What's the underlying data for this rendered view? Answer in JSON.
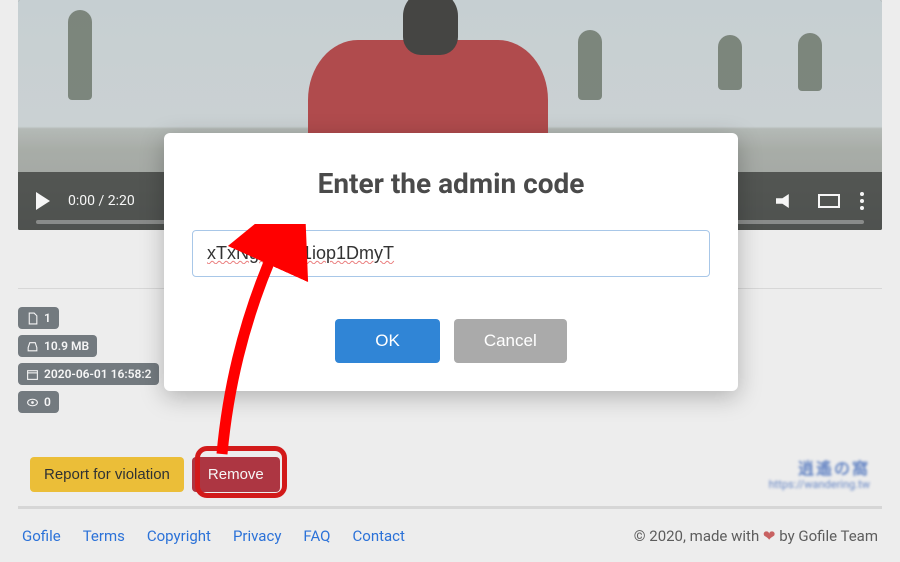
{
  "video": {
    "time_display": "0:00 / 2:20"
  },
  "stats": {
    "file_count": "1",
    "size": "10.9 MB",
    "date": "2020-06-01 16:58:2",
    "views": "0"
  },
  "actions": {
    "report_label": "Report for violation",
    "remove_label": "Remove"
  },
  "footer": {
    "links": [
      "Gofile",
      "Terms",
      "Copyright",
      "Privacy",
      "FAQ",
      "Contact"
    ],
    "credit_prefix": "© 2020, made with ",
    "credit_suffix": " by Gofile Team"
  },
  "modal": {
    "title": "Enter the admin code",
    "input_value": "xTxNgkoFjIj1iop1DmyT",
    "ok_label": "OK",
    "cancel_label": "Cancel"
  }
}
